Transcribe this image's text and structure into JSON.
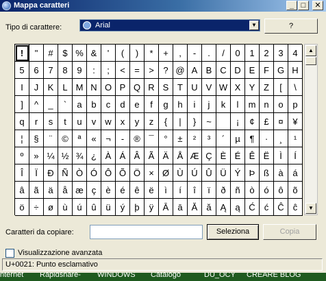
{
  "window": {
    "title": "Mappa caratteri",
    "minimize": "_",
    "maximize": "□",
    "close": "✕"
  },
  "font_label": "Tipo di carattere:",
  "font_value": "Arial",
  "help_button": "?",
  "chars": [
    "!",
    "\"",
    "#",
    "$",
    "%",
    "&",
    "'",
    "(",
    ")",
    "*",
    "+",
    ",",
    "-",
    ".",
    "/",
    "0",
    "1",
    "2",
    "3",
    "4",
    "5",
    "6",
    "7",
    "8",
    "9",
    ":",
    ";",
    "<",
    "=",
    ">",
    "?",
    "@",
    "A",
    "B",
    "C",
    "D",
    "E",
    "F",
    "G",
    "H",
    "I",
    "J",
    "K",
    "L",
    "M",
    "N",
    "O",
    "P",
    "Q",
    "R",
    "S",
    "T",
    "U",
    "V",
    "W",
    "X",
    "Y",
    "Z",
    "[",
    "\\",
    "]",
    "^",
    "_",
    "`",
    "a",
    "b",
    "c",
    "d",
    "e",
    "f",
    "g",
    "h",
    "i",
    "j",
    "k",
    "l",
    "m",
    "n",
    "o",
    "p",
    "q",
    "r",
    "s",
    "t",
    "u",
    "v",
    "w",
    "x",
    "y",
    "z",
    "{",
    "|",
    "}",
    "~",
    " ",
    "¡",
    "¢",
    "£",
    "¤",
    "¥",
    "¦",
    "§",
    "¨",
    "©",
    "ª",
    "«",
    "¬",
    "-",
    "®",
    "¯",
    "°",
    "±",
    "²",
    "³",
    "´",
    "µ",
    "¶",
    "·",
    "¸",
    "¹",
    "º",
    "»",
    "¼",
    "½",
    "¾",
    "¿",
    "À",
    "Á",
    "Â",
    "Ã",
    "Ä",
    "Å",
    "Æ",
    "Ç",
    "È",
    "É",
    "Ê",
    "Ë",
    "Ì",
    "Í",
    "Î",
    "Ï",
    "Ð",
    "Ñ",
    "Ò",
    "Ó",
    "Ô",
    "Õ",
    "Ö",
    "×",
    "Ø",
    "Ù",
    "Ú",
    "Û",
    "Ü",
    "Ý",
    "Þ",
    "ß",
    "à",
    "á",
    "â",
    "ã",
    "ä",
    "å",
    "æ",
    "ç",
    "è",
    "é",
    "ê",
    "ë",
    "ì",
    "í",
    "î",
    "ï",
    "ð",
    "ñ",
    "ò",
    "ó",
    "ô",
    "õ",
    "ö",
    "÷",
    "ø",
    "ù",
    "ú",
    "û",
    "ü",
    "ý",
    "þ",
    "ÿ",
    "Ā",
    "ā",
    "Ă",
    "ă",
    "Ą",
    "ą",
    "Ć",
    "ć",
    "Ĉ",
    "ĉ"
  ],
  "selected_index": 0,
  "copy_label": "Caratteri da copiare:",
  "copy_value": "",
  "select_button": "Seleziona",
  "copy_button": "Copia",
  "advanced_label": "Visualizzazione avanzata",
  "status_text": "U+0021: Punto esclamativo",
  "taskbar_items": [
    "nternet",
    "Rapidshare-",
    "WINDOWS",
    "Catalogo",
    "DU_OCY",
    "CREARE BLOG"
  ],
  "scroll": {
    "up": "▲",
    "down": "▼"
  }
}
